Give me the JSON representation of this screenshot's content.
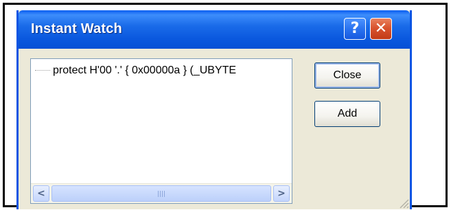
{
  "window": {
    "title": "Instant Watch",
    "help_glyph": "?",
    "close_glyph": "✕"
  },
  "watch_list": {
    "items": [
      {
        "label": "protect H'00 '.' { 0x00000a } (_UBYTE"
      }
    ]
  },
  "scrollbar": {
    "left_arrow": "<",
    "right_arrow": ">"
  },
  "buttons": {
    "close_label": "Close",
    "add_label": "Add"
  },
  "colors": {
    "titlebar": "#0a58de",
    "close_button": "#d9542f",
    "dialog_face": "#ece9d8"
  }
}
